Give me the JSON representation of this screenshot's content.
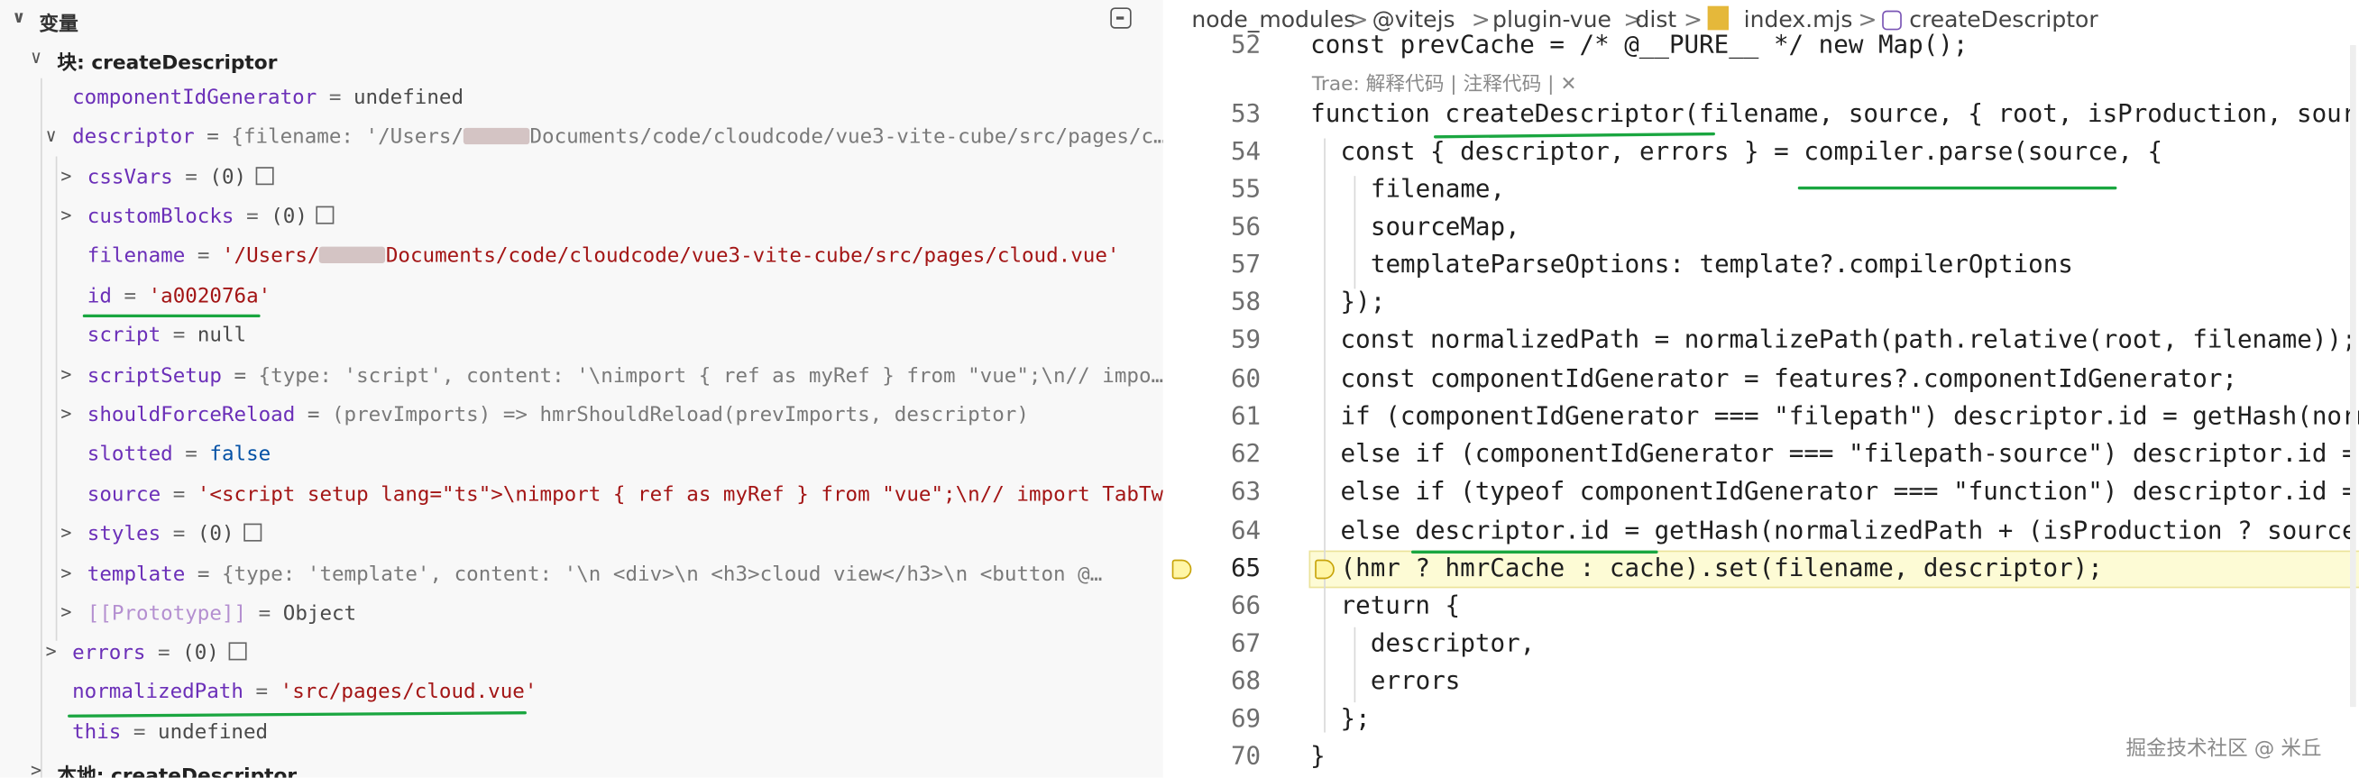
{
  "variables_panel": {
    "title": "变量",
    "scope_block": "块: createDescriptor",
    "rows": [
      {
        "key": "componentIdGenerator",
        "eq": " = ",
        "val": "undefined"
      },
      {
        "key": "descriptor",
        "eq": " = ",
        "val_pre": "{filename: '/Users/",
        "val_post": "Documents/code/cloudcode/vue3-vite-cube/src/pages/c…"
      },
      {
        "key": "cssVars",
        "eq": " = ",
        "val": "(0)"
      },
      {
        "key": "customBlocks",
        "eq": " = ",
        "val": "(0)"
      },
      {
        "key": "filename",
        "eq": " = ",
        "val_pre": "'/Users/",
        "val_post": "Documents/code/cloudcode/vue3-vite-cube/src/pages/cloud.vue'"
      },
      {
        "key": "id",
        "eq": " = ",
        "val": "'a002076a'"
      },
      {
        "key": "script",
        "eq": " = ",
        "val": "null"
      },
      {
        "key": "scriptSetup",
        "eq": " = ",
        "val": "{type: 'script', content: '\\nimport { ref as myRef } from \"vue\";\\n// impo……"
      },
      {
        "key": "shouldForceReload",
        "eq": " = ",
        "val": "(prevImports) => hmrShouldReload(prevImports, descriptor)"
      },
      {
        "key": "slotted",
        "eq": " = ",
        "val": "false"
      },
      {
        "key": "source",
        "eq": " = ",
        "val": "'<script setup lang=\"ts\">\\nimport { ref as myRef } from \"vue\";\\n// import TabTwo…"
      },
      {
        "key": "styles",
        "eq": " = ",
        "val": "(0)"
      },
      {
        "key": "template",
        "eq": " = ",
        "val": "{type: 'template', content: '\\n  <div>\\n    <h3>cloud view</h3>\\n    <button @…"
      },
      {
        "key": "[[Prototype]]",
        "eq": " = ",
        "val": "Object"
      },
      {
        "key": "errors",
        "eq": " = ",
        "val": "(0)"
      },
      {
        "key": "normalizedPath",
        "eq": " = ",
        "val": "'src/pages/cloud.vue'"
      },
      {
        "key": "this",
        "eq": " = ",
        "val": "undefined"
      }
    ],
    "scope_local": "本地: createDescriptor"
  },
  "breadcrumb": {
    "items": [
      "node_modules",
      "@vitejs",
      "plugin-vue",
      "dist",
      "index.mjs",
      "createDescriptor"
    ],
    "separator": ">"
  },
  "inlay_hint": "Trae: 解释代码 | 注释代码 | ✕",
  "code_lines": [
    {
      "n": "52",
      "text": "const prevCache = /* @__PURE__ */ new Map();"
    },
    {
      "n": "53",
      "text": "function createDescriptor(filename, source, { root, isProduction, sourc"
    },
    {
      "n": "54",
      "text": "const { descriptor, errors } = compiler.parse(source, {"
    },
    {
      "n": "55",
      "text": "filename,"
    },
    {
      "n": "56",
      "text": "sourceMap,"
    },
    {
      "n": "57",
      "text": "templateParseOptions: template?.compilerOptions"
    },
    {
      "n": "58",
      "text": "});"
    },
    {
      "n": "59",
      "text": "const normalizedPath = normalizePath(path.relative(root, filename));"
    },
    {
      "n": "60",
      "text": "const componentIdGenerator = features?.componentIdGenerator;"
    },
    {
      "n": "61",
      "text": "if (componentIdGenerator === \"filepath\") descriptor.id = getHash(norm"
    },
    {
      "n": "62",
      "text": "else if (componentIdGenerator === \"filepath-source\") descriptor.id ="
    },
    {
      "n": "63",
      "text": "else if (typeof componentIdGenerator === \"function\") descriptor.id ="
    },
    {
      "n": "64",
      "text": "else descriptor.id = getHash(normalizedPath + (isProduction ? source"
    },
    {
      "n": "65",
      "text": "(hmr ? hmrCache : cache).set(filename, descriptor);"
    },
    {
      "n": "66",
      "text": "return {"
    },
    {
      "n": "67",
      "text": "descriptor,"
    },
    {
      "n": "68",
      "text": "errors"
    },
    {
      "n": "69",
      "text": "};"
    },
    {
      "n": "70",
      "text": "}"
    }
  ],
  "watermark": "掘金技术社区 @ 米丘",
  "colors": {
    "annotation_green": "#1aa640",
    "current_line_bg": "#fdfbd5",
    "keyword_blue": "#0000ff",
    "string_red": "#a31515",
    "property_purple": "#6b2fb8"
  }
}
